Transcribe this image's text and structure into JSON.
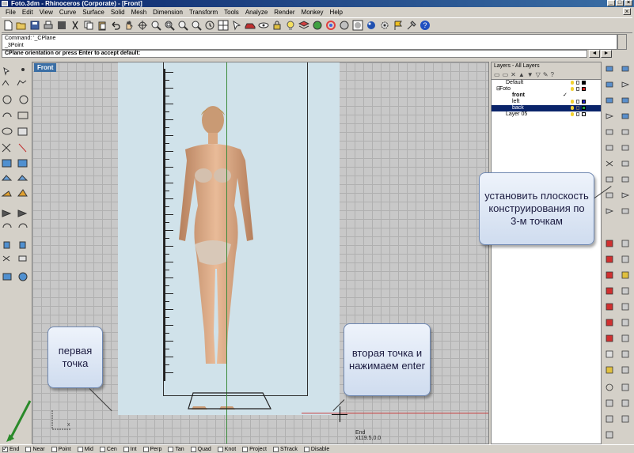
{
  "window": {
    "title": "Foto.3dm - Rhinoceros (Corporate) - [Front]"
  },
  "menu": [
    "File",
    "Edit",
    "View",
    "Curve",
    "Surface",
    "Solid",
    "Mesh",
    "Dimension",
    "Transform",
    "Tools",
    "Analyze",
    "Render",
    "Monkey",
    "Help"
  ],
  "command": {
    "history": [
      "Command: '_CPlane",
      "_3Point"
    ],
    "prompt": "CPlane orientation or press Enter to accept default:"
  },
  "viewport": {
    "name": "Front"
  },
  "layers": {
    "title": "Layers - All Layers",
    "rows": [
      {
        "name": "Default",
        "indent": 1,
        "color": "#000000",
        "selected": false,
        "bold": false
      },
      {
        "name": "Foto",
        "indent": 0,
        "color": "#d02020",
        "selected": false,
        "bold": false,
        "toggle": "⊟"
      },
      {
        "name": "front",
        "indent": 2,
        "color": "#7a3fb0",
        "selected": false,
        "bold": true,
        "check": "✓"
      },
      {
        "name": "left",
        "indent": 2,
        "color": "#2020c0",
        "selected": false,
        "bold": false
      },
      {
        "name": "back",
        "indent": 2,
        "color": "#20a040",
        "selected": true,
        "bold": false
      },
      {
        "name": "Layer 05",
        "indent": 1,
        "color": "#ffffff",
        "selected": false,
        "bold": false
      }
    ]
  },
  "callouts": {
    "first": "первая точка",
    "second": "вторая точка и нажимаем enter",
    "third": "установить плоскость конструирования по 3-м точкам"
  },
  "cursor_readout": {
    "label": "End",
    "coords": "x119.5,0.0"
  },
  "osnaps": [
    {
      "label": "End",
      "checked": true
    },
    {
      "label": "Near",
      "checked": false
    },
    {
      "label": "Point",
      "checked": false
    },
    {
      "label": "Mid",
      "checked": false
    },
    {
      "label": "Cen",
      "checked": false
    },
    {
      "label": "Int",
      "checked": false
    },
    {
      "label": "Perp",
      "checked": false
    },
    {
      "label": "Tan",
      "checked": false
    },
    {
      "label": "Quad",
      "checked": false
    },
    {
      "label": "Knot",
      "checked": false
    },
    {
      "label": "Project",
      "checked": false
    },
    {
      "label": "STrack",
      "checked": false
    },
    {
      "label": "Disable",
      "checked": false
    }
  ],
  "colors": {
    "titlebar": "#0a246a",
    "viewport_bg": "#c8c8c8",
    "photo_bg": "#d0e2ea",
    "callout_border": "#6d86b0",
    "arrow": "#2a8a2a"
  }
}
